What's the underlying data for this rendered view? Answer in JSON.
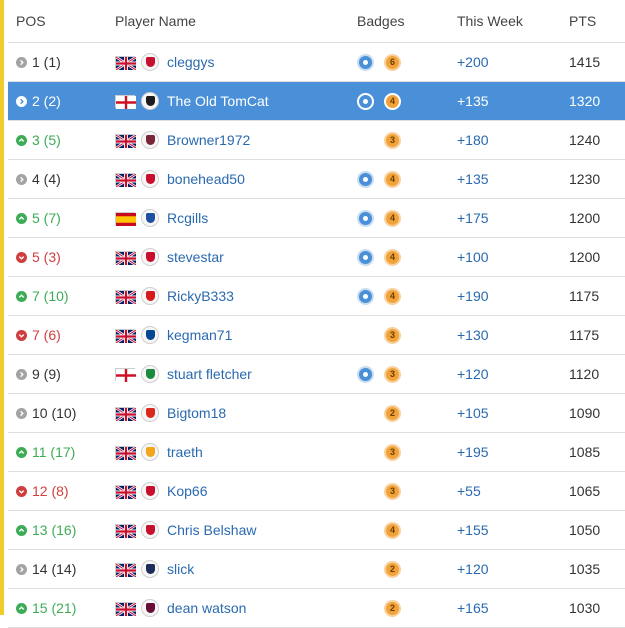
{
  "header": {
    "pos": "POS",
    "player": "Player Name",
    "badges": "Badges",
    "week": "This Week",
    "pts": "PTS"
  },
  "colors": {
    "highlight": "#4a90d9",
    "up": "#3eac57",
    "down": "#cf3f3f",
    "same": "#a3a3a3",
    "link": "#2a6ab0",
    "badge_blue": "#4a90d9",
    "badge_orange": "#f1a33a"
  },
  "rows": [
    {
      "pos": "1 (1)",
      "trend": "same",
      "flag": "uk",
      "crest": "#c8102e",
      "name": "cleggys",
      "blue_badge": true,
      "orange_badge": "6",
      "week": "+200",
      "pts": "1415",
      "highlight": false
    },
    {
      "pos": "2 (2)",
      "trend": "same",
      "flag": "england",
      "crest": "#1c1c1c",
      "name": "The Old TomCat",
      "blue_badge": true,
      "orange_badge": "4",
      "week": "+135",
      "pts": "1320",
      "highlight": true
    },
    {
      "pos": "3 (5)",
      "trend": "up",
      "flag": "uk",
      "crest": "#7a263a",
      "name": "Browner1972",
      "blue_badge": false,
      "orange_badge": "3",
      "week": "+180",
      "pts": "1240",
      "highlight": false
    },
    {
      "pos": "4 (4)",
      "trend": "same",
      "flag": "uk",
      "crest": "#c8102e",
      "name": "bonehead50",
      "blue_badge": true,
      "orange_badge": "4",
      "week": "+135",
      "pts": "1230",
      "highlight": false
    },
    {
      "pos": "5 (7)",
      "trend": "up",
      "flag": "spain",
      "crest": "#1f4fa0",
      "name": "Rcgills",
      "blue_badge": true,
      "orange_badge": "4",
      "week": "+175",
      "pts": "1200",
      "highlight": false
    },
    {
      "pos": "5 (3)",
      "trend": "down",
      "flag": "uk",
      "crest": "#c8102e",
      "name": "stevestar",
      "blue_badge": true,
      "orange_badge": "4",
      "week": "+100",
      "pts": "1200",
      "highlight": false
    },
    {
      "pos": "7 (10)",
      "trend": "up",
      "flag": "uk",
      "crest": "#d7191c",
      "name": "RickyB333",
      "blue_badge": true,
      "orange_badge": "4",
      "week": "+190",
      "pts": "1175",
      "highlight": false
    },
    {
      "pos": "7 (6)",
      "trend": "down",
      "flag": "uk",
      "crest": "#034694",
      "name": "kegman71",
      "blue_badge": false,
      "orange_badge": "3",
      "week": "+130",
      "pts": "1175",
      "highlight": false
    },
    {
      "pos": "9 (9)",
      "trend": "same",
      "flag": "england",
      "crest": "#1a8a3e",
      "name": "stuart fletcher",
      "blue_badge": true,
      "orange_badge": "3",
      "week": "+120",
      "pts": "1120",
      "highlight": false
    },
    {
      "pos": "10 (10)",
      "trend": "same",
      "flag": "uk",
      "crest": "#da291c",
      "name": "Bigtom18",
      "blue_badge": false,
      "orange_badge": "2",
      "week": "+105",
      "pts": "1090",
      "highlight": false
    },
    {
      "pos": "11 (17)",
      "trend": "up",
      "flag": "uk",
      "crest": "#f4a51c",
      "name": "traeth",
      "blue_badge": false,
      "orange_badge": "3",
      "week": "+195",
      "pts": "1085",
      "highlight": false
    },
    {
      "pos": "12 (8)",
      "trend": "down",
      "flag": "uk",
      "crest": "#c8102e",
      "name": "Kop66",
      "blue_badge": false,
      "orange_badge": "3",
      "week": "+55",
      "pts": "1065",
      "highlight": false
    },
    {
      "pos": "13 (16)",
      "trend": "up",
      "flag": "uk",
      "crest": "#c8102e",
      "name": "Chris Belshaw",
      "blue_badge": false,
      "orange_badge": "4",
      "week": "+155",
      "pts": "1050",
      "highlight": false
    },
    {
      "pos": "14 (14)",
      "trend": "same",
      "flag": "uk",
      "crest": "#1c2c5b",
      "name": "slick",
      "blue_badge": false,
      "orange_badge": "2",
      "week": "+120",
      "pts": "1035",
      "highlight": false
    },
    {
      "pos": "15 (21)",
      "trend": "up",
      "flag": "uk",
      "crest": "#670e36",
      "name": "dean watson",
      "blue_badge": false,
      "orange_badge": "2",
      "week": "+165",
      "pts": "1030",
      "highlight": false
    }
  ]
}
